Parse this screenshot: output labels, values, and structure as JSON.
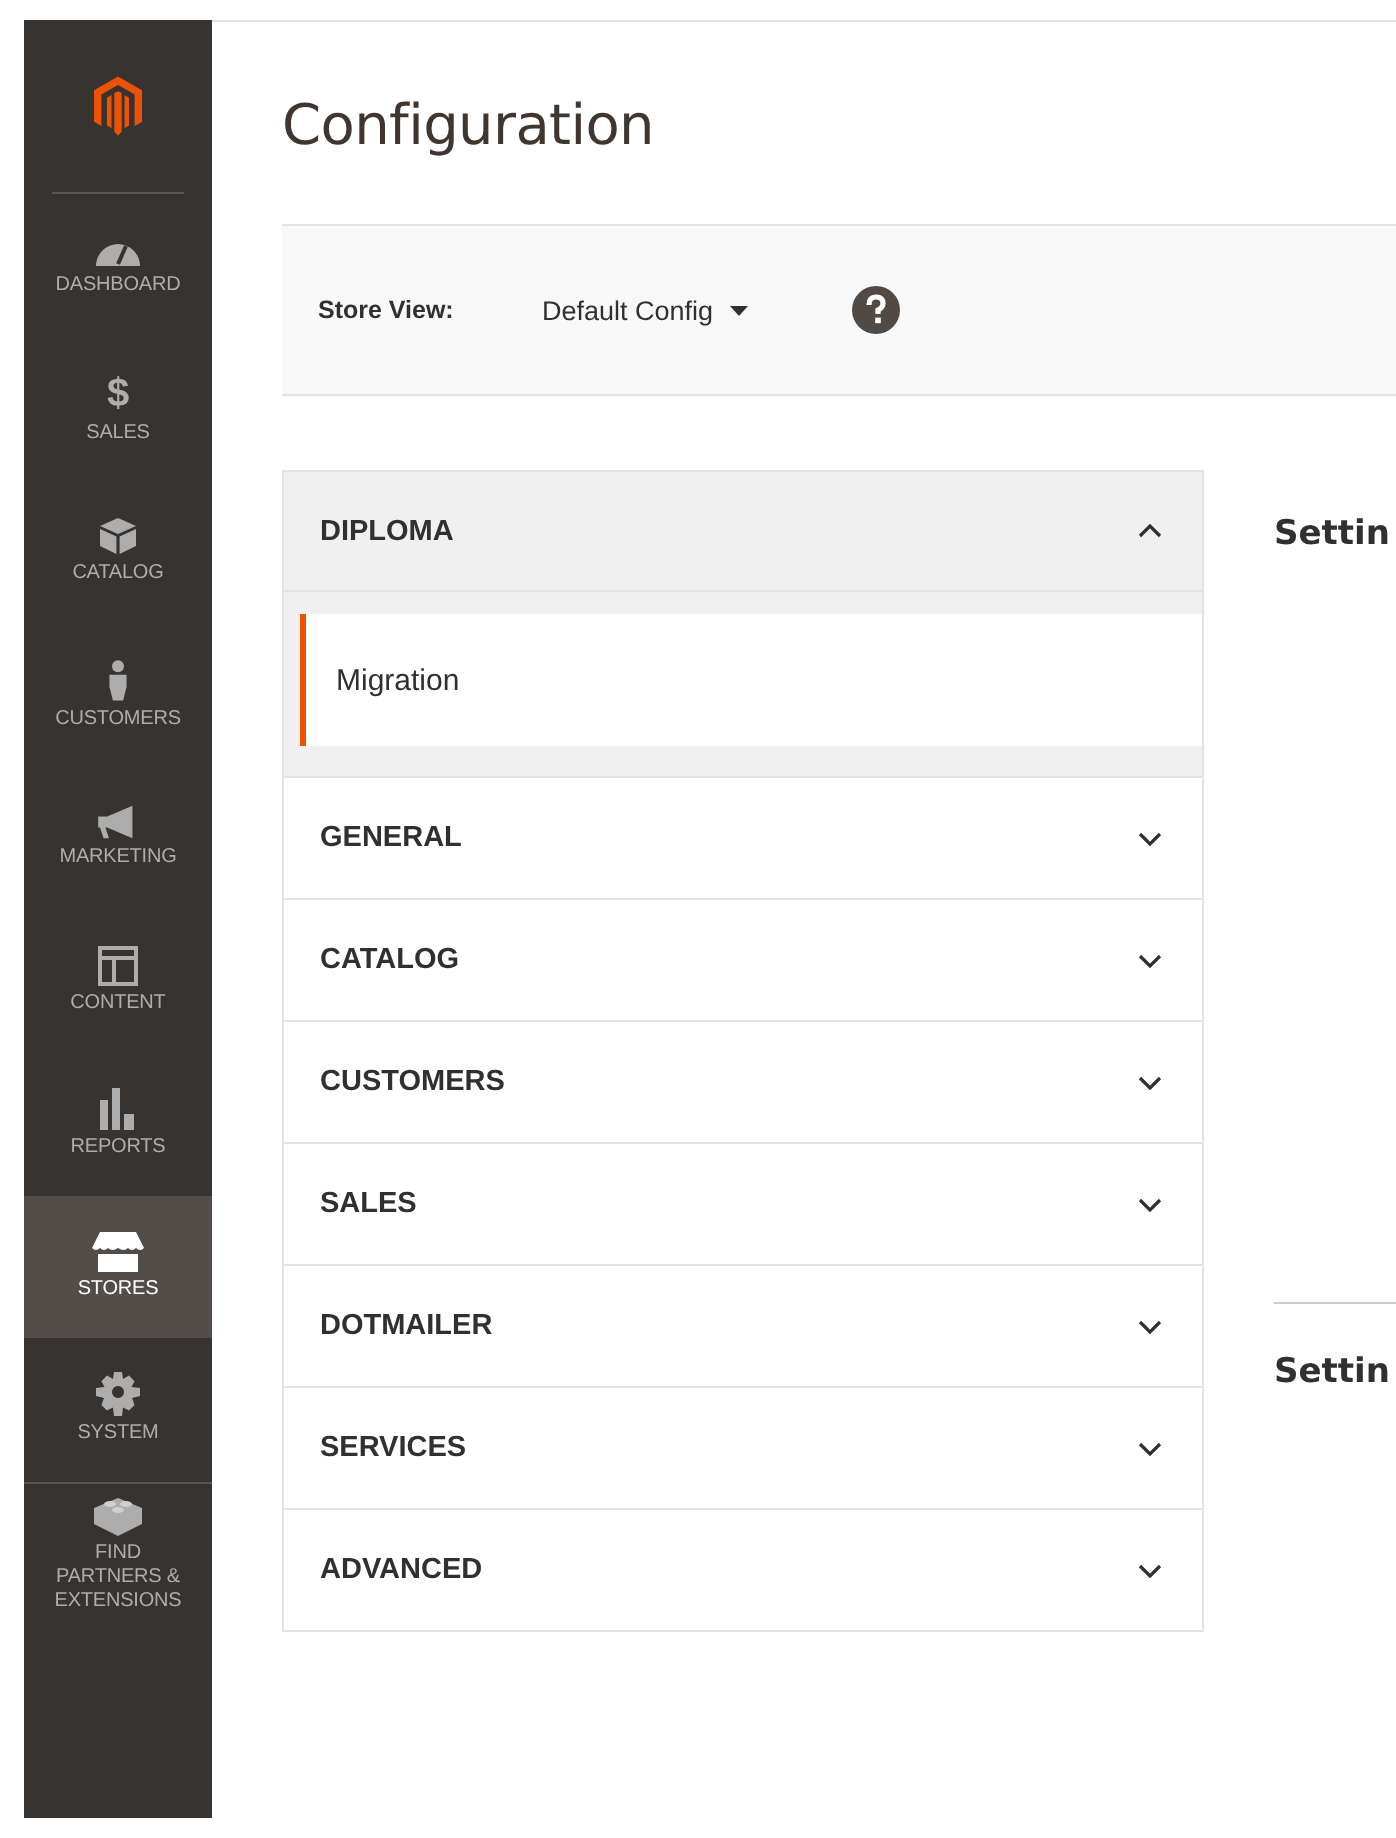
{
  "sidebar": {
    "items": [
      {
        "label": "DASHBOARD",
        "kind": "gauge",
        "selected": false
      },
      {
        "label": "SALES",
        "kind": "glyph",
        "glyph": "$",
        "selected": false
      },
      {
        "label": "CATALOG",
        "kind": "box",
        "selected": false
      },
      {
        "label": "CUSTOMERS",
        "kind": "person",
        "selected": false
      },
      {
        "label": "MARKETING",
        "kind": "megaphone",
        "selected": false
      },
      {
        "label": "CONTENT",
        "kind": "layout",
        "selected": false
      },
      {
        "label": "REPORTS",
        "kind": "bars",
        "selected": false
      },
      {
        "label": "STORES",
        "kind": "storefront",
        "selected": true
      },
      {
        "label": "SYSTEM",
        "kind": "gear",
        "selected": false
      },
      {
        "label": "FIND PARTNERS & EXTENSIONS",
        "kind": "brick",
        "selected": false
      }
    ]
  },
  "page_title": "Configuration",
  "store_view": {
    "label": "Store View:",
    "value": "Default Config"
  },
  "config_tabs": [
    {
      "title": "DIPLOMA",
      "expanded": true,
      "children": [
        {
          "label": "Migration",
          "selected": true
        }
      ]
    },
    {
      "title": "GENERAL",
      "expanded": false
    },
    {
      "title": "CATALOG",
      "expanded": false
    },
    {
      "title": "CUSTOMERS",
      "expanded": false
    },
    {
      "title": "SALES",
      "expanded": false
    },
    {
      "title": "DOTMAILER",
      "expanded": false
    },
    {
      "title": "SERVICES",
      "expanded": false
    },
    {
      "title": "ADVANCED",
      "expanded": false
    }
  ],
  "content": {
    "section_titles": [
      "Settin",
      "Settin"
    ]
  }
}
